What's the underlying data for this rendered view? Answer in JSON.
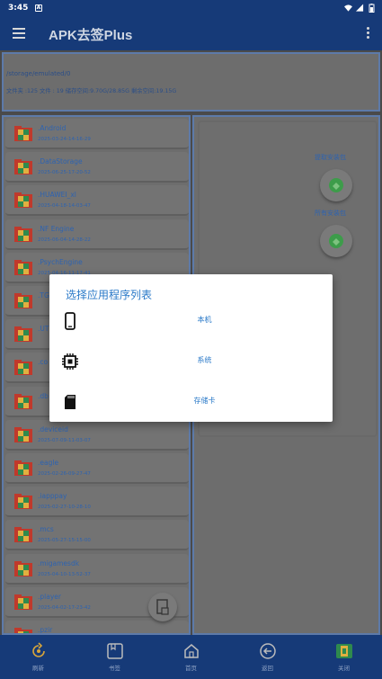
{
  "status_bar": {
    "time": "3:45",
    "notification_badge": "A"
  },
  "app_bar": {
    "title": "APK去签Plus"
  },
  "path_panel": {
    "path": "/storage/emulated/0",
    "stats": "文件夹 :125   文件 :  19   储存空间:9.70G/28.85G  剩余空间:19.15G"
  },
  "files": [
    {
      "name": ".Android",
      "date": "2025-03-24-14-16-29"
    },
    {
      "name": ".DataStorage",
      "date": "2025-06-25-17-20-52"
    },
    {
      "name": ".HUAWEI_xl",
      "date": "2025-04-18-14-03-47"
    },
    {
      "name": ".NF Engine",
      "date": "2025-06-04-14-28-22"
    },
    {
      "name": ".PsychEngine",
      "date": "2025-04-16-11-17-41"
    },
    {
      "name": ".TG",
      "date": ""
    },
    {
      "name": ".UT",
      "date": ""
    },
    {
      "name": ".co",
      "date": ""
    },
    {
      "name": ".db",
      "date": ""
    },
    {
      "name": ".deviceid",
      "date": "2025-07-09-11-03-07"
    },
    {
      "name": ".eagle",
      "date": "2025-02-26-09-27-47"
    },
    {
      "name": ".iapppay",
      "date": "2025-02-27-10-28-10"
    },
    {
      "name": ".mcs",
      "date": "2025-05-27-15-15-00"
    },
    {
      "name": ".migamesdk",
      "date": "2025-04-10-13-52-37"
    },
    {
      "name": ".player",
      "date": "2025-04-02-17-23-42"
    },
    {
      "name": ".pzir",
      "date": ""
    }
  ],
  "side_panel": {
    "extract_label": "提取安装包",
    "all_label": "所有安装包"
  },
  "dialog": {
    "title": "选择应用程序列表",
    "options": [
      {
        "label": "本机",
        "icon": "phone-icon"
      },
      {
        "label": "系统",
        "icon": "chip-icon"
      },
      {
        "label": "存储卡",
        "icon": "sdcard-icon"
      }
    ]
  },
  "bottom_nav": [
    {
      "label": "刷新",
      "icon": "refresh-icon"
    },
    {
      "label": "书签",
      "icon": "bookmark-icon"
    },
    {
      "label": "首页",
      "icon": "home-icon"
    },
    {
      "label": "返回",
      "icon": "back-icon"
    },
    {
      "label": "关闭",
      "icon": "close-app-icon"
    }
  ],
  "colors": {
    "app_bar": "#163a78",
    "accent_text": "#2e63b0",
    "dialog_text": "#2a79c8"
  }
}
